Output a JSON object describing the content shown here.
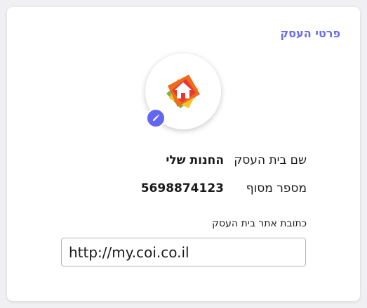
{
  "card": {
    "title": "פרטי העסק"
  },
  "logo": {
    "icon": "house-logo-icon",
    "edit_icon": "pencil-icon"
  },
  "fields": {
    "business_name_label": "שם בית העסק",
    "business_name_value": "החנות שלי",
    "dealer_number_label": "מספר מסוף",
    "dealer_number_value": "5698874123",
    "website_label": "כתובת אתר בית העסק",
    "website_value": "http://my.coi.co.il"
  },
  "colors": {
    "accent": "#6366f1",
    "title": "#6a6de8"
  }
}
